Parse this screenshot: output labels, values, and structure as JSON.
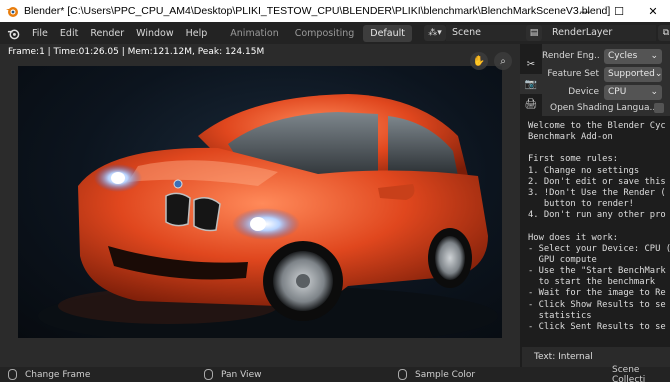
{
  "window": {
    "title": "Blender* [C:\\Users\\PPC_CPU_AM4\\Desktop\\PLIKI_TESTOW_CPU\\BLENDER\\PLIKI\\blenchmark\\BlenchMarkSceneV3.blend]",
    "minimize": "—",
    "maximize": "☐",
    "close": "✕"
  },
  "menubar": {
    "items": [
      "File",
      "Edit",
      "Render",
      "Window",
      "Help"
    ],
    "workspaces": [
      "Animation",
      "Compositing",
      "Default"
    ],
    "active_workspace": "Default",
    "scene": "Scene",
    "view_layer": "RenderLayer"
  },
  "viewport": {
    "info": "Frame:1 | Time:01:26.05 | Mem:121.12M, Peak: 124.15M"
  },
  "properties": {
    "render_engine_label": "Render Eng..",
    "render_engine_value": "Cycles",
    "feature_set_label": "Feature Set",
    "feature_set_value": "Supported",
    "device_label": "Device",
    "device_value": "CPU",
    "open_shading_label": "Open Shading Langua..."
  },
  "text_editor": {
    "lines": [
      "Welcome to the Blender Cyc",
      "Benchmark Add-on",
      "",
      "First some rules:",
      "1. Change no settings",
      "2. Don't edit or save this",
      "3. !Don't Use the Render (",
      "   button to render!",
      "4. Don't run any other pro",
      "",
      "How does it work:",
      "- Select your Device: CPU (",
      "  GPU compute",
      "- Use the \"Start BenchMark",
      "  to start the benchmark",
      "- Wait for the image to Re",
      "- Click Show Results to se",
      "  statistics",
      "- Click Sent Results to se"
    ],
    "footer": "Text: Internal"
  },
  "statusbar": {
    "left": "Change Frame",
    "middle": "Pan View",
    "right": "Sample Color",
    "far_right": "Scene Collecti"
  }
}
